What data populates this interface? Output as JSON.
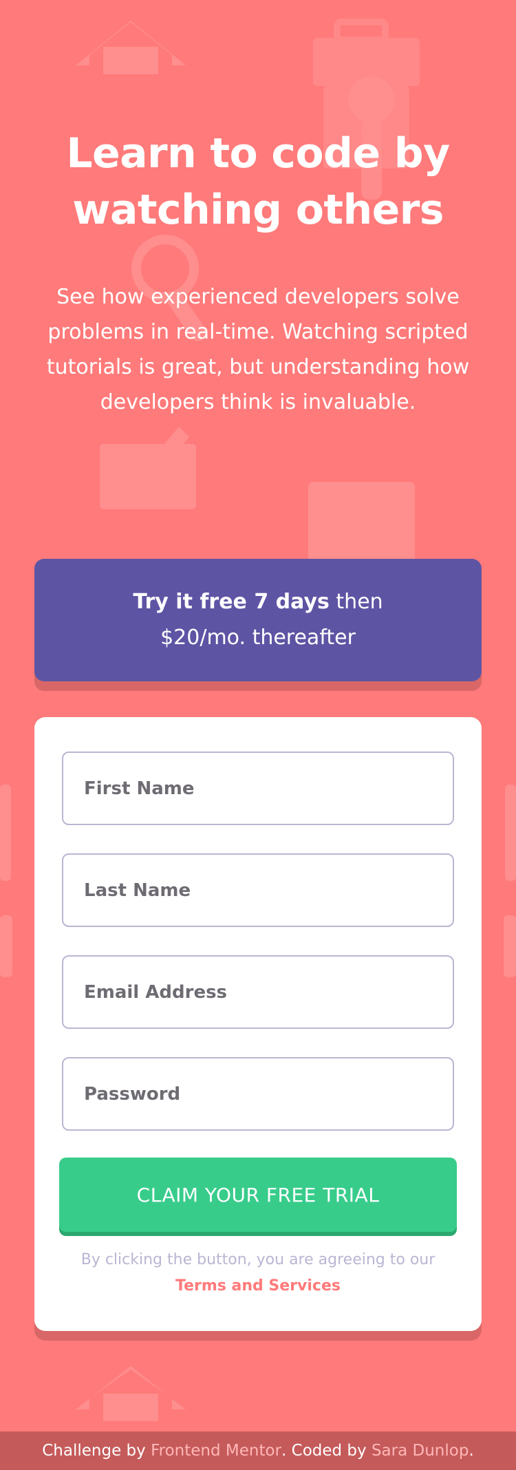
{
  "hero": {
    "title": "Learn to code by watching others",
    "subtitle": "See how experienced developers solve problems in real-time. Watching scripted tutorials is great, but understanding how developers think is invaluable."
  },
  "promo": {
    "bold": "Try it free 7 days",
    "rest": "then $20/mo. thereafter"
  },
  "form": {
    "first_name_placeholder": "First Name",
    "last_name_placeholder": "Last Name",
    "email_placeholder": "Email Address",
    "password_placeholder": "Password",
    "submit_label": "CLAIM YOUR FREE TRIAL",
    "terms_prefix": "By clicking the button, you are agreeing to our",
    "terms_link": "Terms and Services"
  },
  "footer": {
    "prefix": "Challenge by",
    "fm_link": "Frontend Mentor",
    "middle": ". Coded by",
    "author_link": "Sara Dunlop",
    "suffix": "."
  },
  "colors": {
    "background": "#FF7A7A",
    "promo": "#5E54A4",
    "cta": "#38CC8B",
    "footer": "#C55A5A",
    "link": "#FF7A7A"
  },
  "icons": {
    "background": [
      "house-icon",
      "toolbox-icon",
      "wrench-icon",
      "browser-window-icon",
      "edit-note-icon",
      "magnifier-icon"
    ]
  }
}
